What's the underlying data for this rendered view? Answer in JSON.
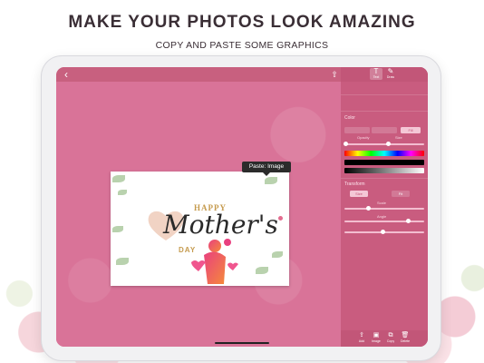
{
  "promo": {
    "headline": "MAKE YOUR PHOTOS LOOK AMAZING",
    "subline": "COPY AND PASTE SOME GRAPHICS"
  },
  "app": {
    "back_icon": "chevron-left-icon",
    "share_icon": "share-icon",
    "tabs": [
      {
        "glyph": "T",
        "label": "Text",
        "icon": "text-icon",
        "active": true
      },
      {
        "glyph": "✎",
        "label": "Draw",
        "icon": "draw-icon",
        "active": false
      }
    ]
  },
  "card": {
    "happy": "HAPPY",
    "mothers": "Mother's",
    "day": "DAY"
  },
  "context_menu": {
    "paste_label": "Paste: Image"
  },
  "panel": {
    "color_title": "Color",
    "transform_title": "Transform",
    "color_options": [
      "",
      "",
      "Fill"
    ],
    "transform_options": [
      "Size",
      "Fit"
    ],
    "slider_labels": [
      "Opacity",
      "Size",
      "Scale",
      "Angle"
    ],
    "colors": {
      "panel_bg": "#c95c7f",
      "canvas_bg": "#d97398",
      "accent": "#f4c7d6"
    }
  },
  "bottom_actions": [
    {
      "glyph": "⇪",
      "label": "Add",
      "icon": "add-icon"
    },
    {
      "glyph": "▣",
      "label": "Image",
      "icon": "image-icon"
    },
    {
      "glyph": "⧉",
      "label": "Copy",
      "icon": "copy-icon"
    },
    {
      "glyph": "🗑",
      "label": "Delete",
      "icon": "trash-icon"
    }
  ]
}
